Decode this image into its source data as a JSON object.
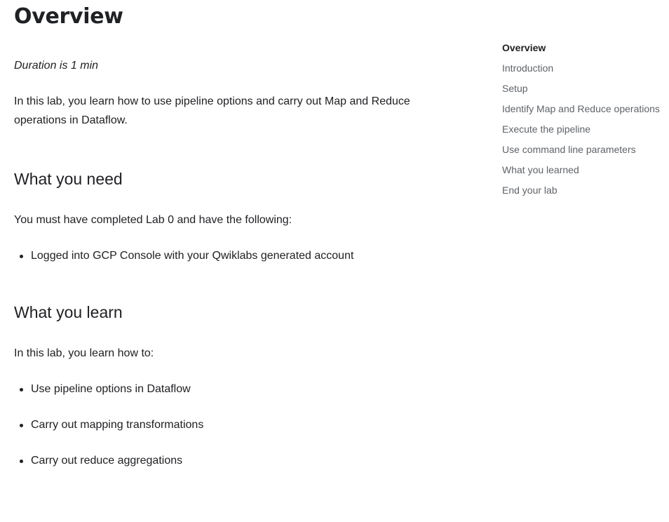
{
  "main": {
    "title": "Overview",
    "duration": "Duration is 1 min",
    "intro": "In this lab, you learn how to use pipeline options and carry out Map and Reduce operations in Dataflow.",
    "need": {
      "heading": "What you need",
      "text": "You must have completed Lab 0 and have the following:",
      "items": [
        "Logged into GCP Console with your Qwiklabs generated account"
      ]
    },
    "learn": {
      "heading": "What you learn",
      "text": "In this lab, you learn how to:",
      "items": [
        "Use pipeline options in Dataflow",
        "Carry out mapping transformations",
        "Carry out reduce aggregations"
      ]
    }
  },
  "toc": {
    "active_index": 0,
    "items": [
      "Overview",
      "Introduction",
      "Setup",
      "Identify Map and Reduce operations",
      "Execute the pipeline",
      "Use command line parameters",
      "What you learned",
      "End your lab"
    ]
  },
  "colors": {
    "text": "#202124",
    "toc_text": "#5f6368"
  }
}
